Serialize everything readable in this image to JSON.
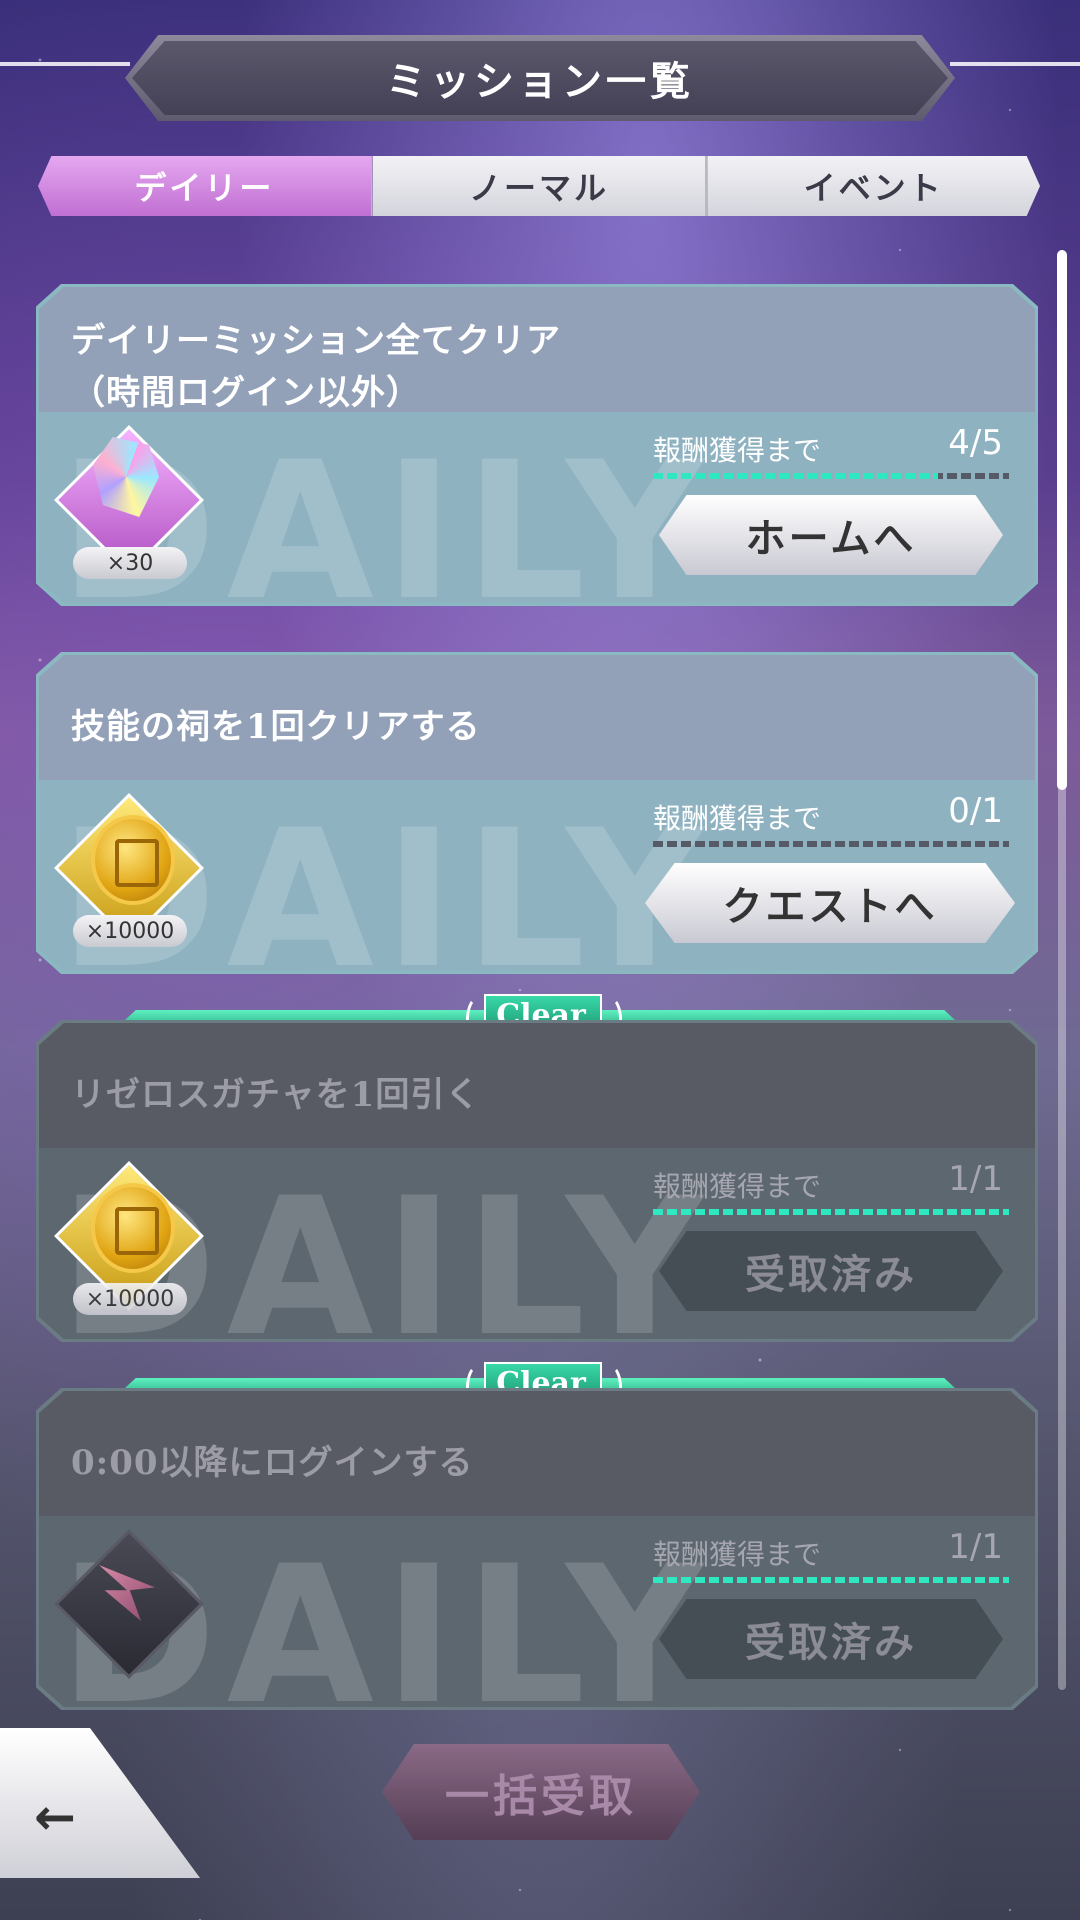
{
  "header": {
    "title": "ミッション一覧"
  },
  "tabs": [
    {
      "label": "デイリー",
      "active": true
    },
    {
      "label": "ノーマル",
      "active": false
    },
    {
      "label": "イベント",
      "active": false
    }
  ],
  "watermark_text": "DAILY",
  "clear_label": "Clear",
  "missions": [
    {
      "title_line1": "デイリーミッション全てクリア",
      "title_line2": "（時間ログイン以外）",
      "reward_icon": "gem-icon",
      "reward_qty": "×30",
      "progress_label": "報酬獲得まで",
      "progress_value": "4/5",
      "progress_fraction": 0.8,
      "button_label": "ホームへ",
      "cleared": false
    },
    {
      "title_line1": "技能の祠を1回クリアする",
      "reward_icon": "coin-icon",
      "reward_qty": "×10000",
      "progress_label": "報酬獲得まで",
      "progress_value": "0/1",
      "progress_fraction": 0.0,
      "button_label": "クエストへ",
      "cleared": false
    },
    {
      "title_line1": "リゼロスガチャを1回引く",
      "reward_icon": "coin-icon",
      "reward_qty": "×10000",
      "progress_label": "報酬獲得まで",
      "progress_value": "1/1",
      "progress_fraction": 1.0,
      "button_label": "受取済み",
      "cleared": true
    },
    {
      "title_line1": "0:00以降にログインする",
      "reward_icon": "bolt-icon",
      "reward_qty": "",
      "progress_label": "報酬獲得まで",
      "progress_value": "1/1",
      "progress_fraction": 1.0,
      "button_label": "受取済み",
      "cleared": true
    }
  ],
  "bottom": {
    "bulk_receive_label": "一括受取",
    "back_icon": "back-arrow-icon"
  }
}
